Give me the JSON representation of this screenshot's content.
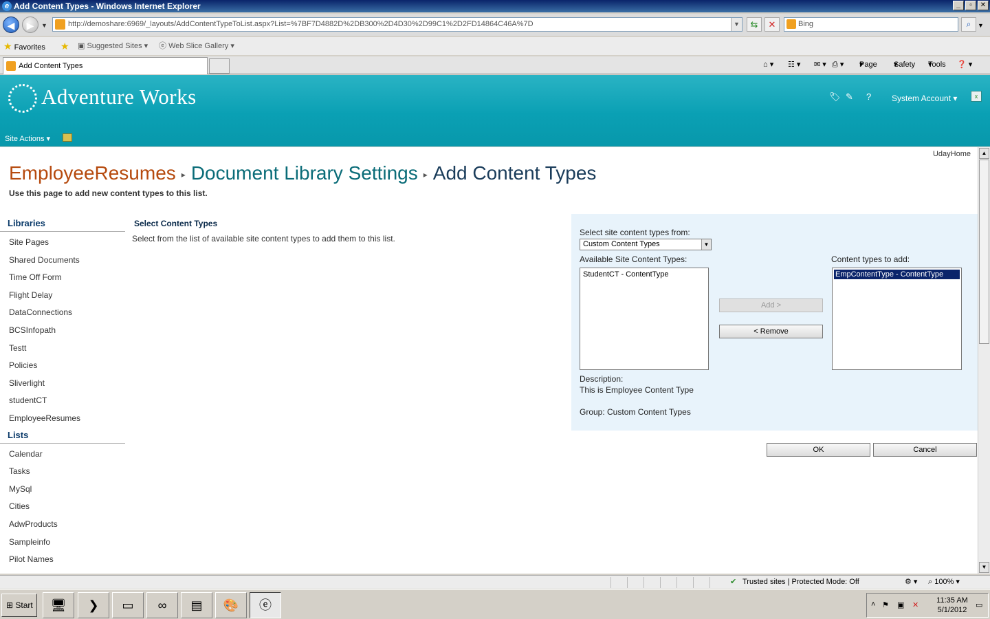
{
  "window": {
    "title": "Add Content Types - Windows Internet Explorer",
    "min": "_",
    "max": "▫",
    "close": "✕"
  },
  "addressbar": {
    "url": "http://demoshare:6969/_layouts/AddContentTypeToList.aspx?List=%7BF7D4882D%2DB300%2D4D30%2D99C1%2D2FD14864C46A%7D",
    "search_placeholder": "Bing"
  },
  "favorites": {
    "favorites_label": "Favorites",
    "suggested_sites": "Suggested Sites",
    "web_slice_gallery": "Web Slice Gallery"
  },
  "tabs": {
    "active_tab": "Add Content Types"
  },
  "commandbar": {
    "page": "Page",
    "safety": "Safety",
    "tools": "Tools"
  },
  "header": {
    "brand": "Adventure Works",
    "user": "System Account",
    "site_actions": "Site Actions"
  },
  "page": {
    "user_home": "UdayHome",
    "breadcrumb": [
      "EmployeeResumes",
      "Document Library Settings",
      "Add Content Types"
    ],
    "description": "Use this page to add new content types to this list."
  },
  "quicklaunch": {
    "libraries_heading": "Libraries",
    "libraries": [
      "Site Pages",
      "Shared Documents",
      "Time Off Form",
      "Flight Delay",
      "DataConnections",
      "BCSInfopath",
      "Testt",
      "Policies",
      "Sliverlight",
      "studentCT",
      "EmployeeResumes"
    ],
    "lists_heading": "Lists",
    "lists": [
      "Calendar",
      "Tasks",
      "MySql",
      "Cities",
      "AdwProducts",
      "Sampleinfo",
      "Pilot Names"
    ]
  },
  "section": {
    "title": "Select Content Types",
    "description": "Select from the list of available site content types to add them to this list."
  },
  "panel": {
    "select_from_label": "Select site content types from:",
    "select_from_value": "Custom Content Types",
    "available_label": "Available Site Content Types:",
    "available": [
      "StudentCT - ContentType"
    ],
    "to_add_label": "Content types to add:",
    "to_add": [
      "EmpContentType - ContentType"
    ],
    "add_button": "Add >",
    "remove_button": "< Remove",
    "description_label": "Description:",
    "description_value": "This is Employee Content Type",
    "group_text": "Group: Custom Content Types"
  },
  "buttons": {
    "ok": "OK",
    "cancel": "Cancel"
  },
  "statusbar": {
    "zone": "Trusted sites | Protected Mode: Off",
    "zoom": "100%"
  },
  "taskbar": {
    "start": "Start",
    "time": "11:35 AM",
    "date": "5/1/2012"
  }
}
